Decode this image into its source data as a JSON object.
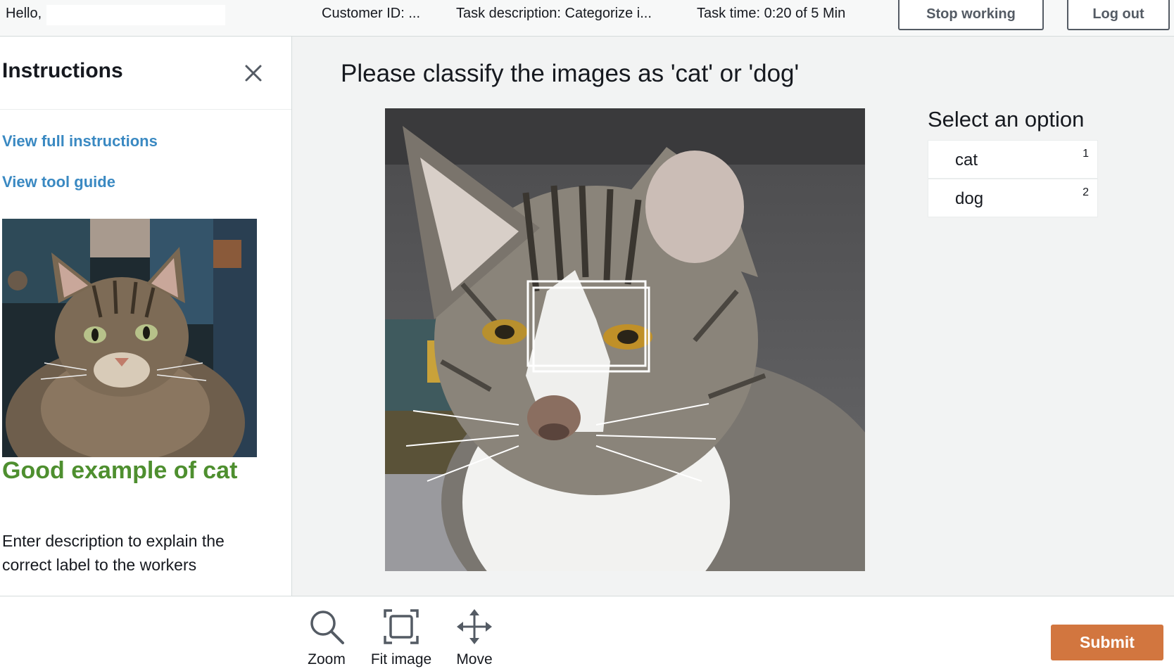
{
  "header": {
    "greeting": "Hello,",
    "customer_id": "Customer ID: ...",
    "task_description": "Task description: Categorize i...",
    "task_time": "Task time: 0:20 of 5 Min",
    "stop_working_label": "Stop working",
    "log_out_label": "Log out"
  },
  "instructions": {
    "title": "Instructions",
    "links": [
      "View full instructions",
      "View tool guide"
    ],
    "example_caption": "Good example of cat",
    "example_description": "Enter description to explain the correct label to the workers"
  },
  "task": {
    "question": "Please classify the images as 'cat' or 'dog'",
    "options_title": "Select an option",
    "options": [
      {
        "label": "cat",
        "shortcut": "1"
      },
      {
        "label": "dog",
        "shortcut": "2"
      }
    ]
  },
  "toolbar": {
    "tools": [
      {
        "label": "Zoom",
        "icon": "zoom-icon"
      },
      {
        "label": "Fit image",
        "icon": "fit-image-icon"
      },
      {
        "label": "Move",
        "icon": "move-icon"
      }
    ],
    "submit_label": "Submit"
  },
  "colors": {
    "link": "#3a89c2",
    "example_caption": "#4e8f2f",
    "submit": "#d2763f",
    "workspace_bg": "#f2f3f3"
  }
}
